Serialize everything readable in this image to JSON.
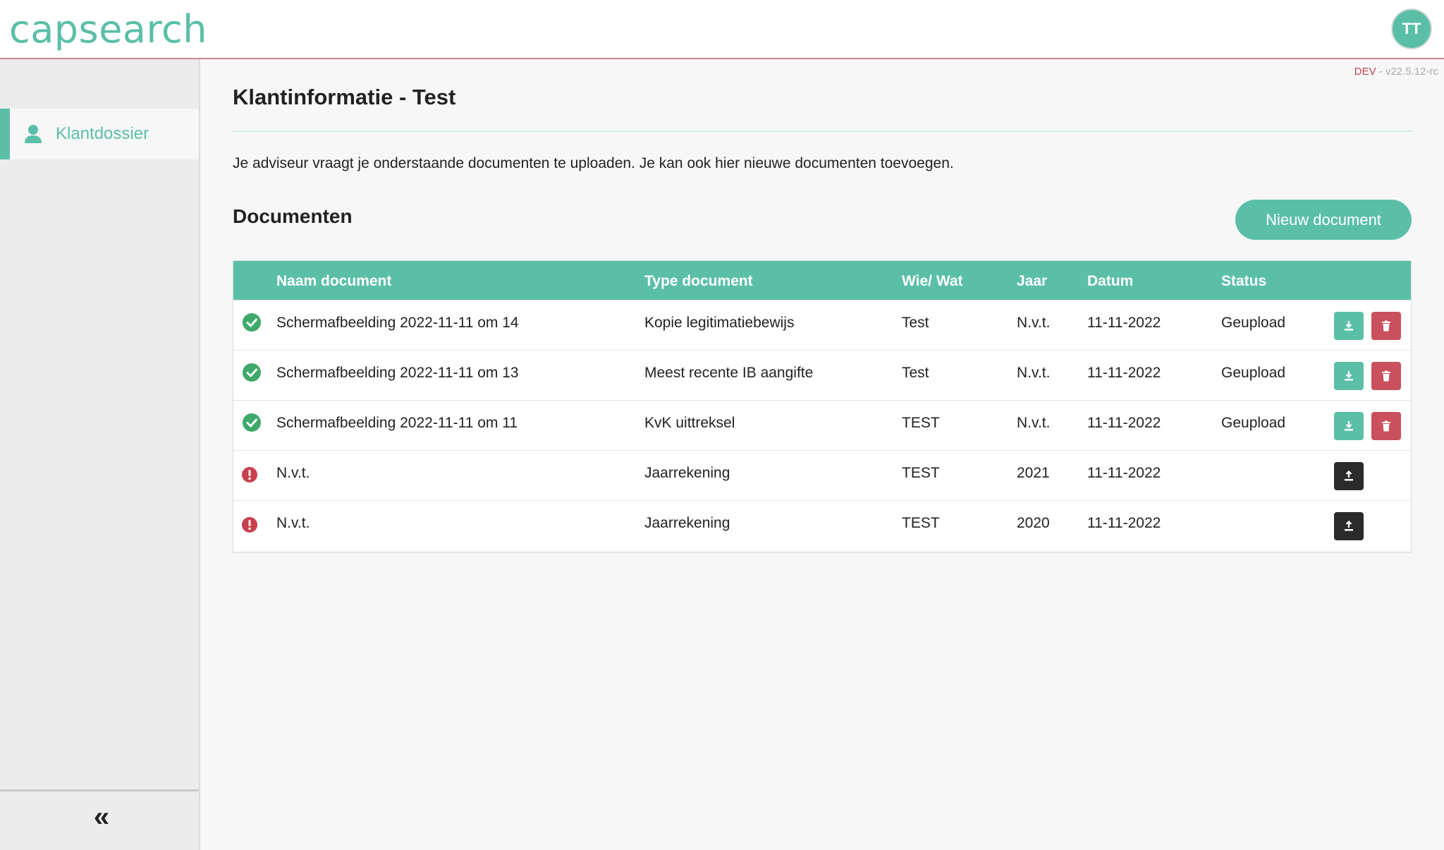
{
  "app": {
    "logo": "capsearch",
    "user_initials": "TT",
    "env_label": "DEV",
    "env_separator": " - ",
    "version": "v22.5.12-rc"
  },
  "sidebar": {
    "items": [
      {
        "label": "Klantdossier",
        "icon": "person-icon",
        "active": true
      }
    ],
    "collapse_icon": "double-chevron-left-icon",
    "collapse_glyph": "«"
  },
  "main": {
    "title": "Klantinformatie - Test",
    "intro": "Je adviseur vraagt je onderstaande documenten te uploaden. Je kan ook hier nieuwe documenten toevoegen.",
    "section_title": "Documenten",
    "new_button": "Nieuw document"
  },
  "table": {
    "headers": {
      "name": "Naam document",
      "type": "Type document",
      "who": "Wie/ Wat",
      "year": "Jaar",
      "date": "Datum",
      "status": "Status"
    },
    "rows": [
      {
        "state": "ok",
        "name": "Schermafbeelding 2022-11-11 om 14",
        "type": "Kopie legitimatiebewijs",
        "who": "Test",
        "year": "N.v.t.",
        "date": "11-11-2022",
        "status": "Geupload",
        "actions": [
          "download-icon",
          "trash-icon"
        ]
      },
      {
        "state": "ok",
        "name": "Schermafbeelding 2022-11-11 om 13",
        "type": "Meest recente IB aangifte",
        "who": "Test",
        "year": "N.v.t.",
        "date": "11-11-2022",
        "status": "Geupload",
        "actions": [
          "download-icon",
          "trash-icon"
        ]
      },
      {
        "state": "ok",
        "name": "Schermafbeelding 2022-11-11 om 11",
        "type": "KvK uittreksel",
        "who": "TEST",
        "year": "N.v.t.",
        "date": "11-11-2022",
        "status": "Geupload",
        "actions": [
          "download-icon",
          "trash-icon"
        ]
      },
      {
        "state": "missing",
        "name": "N.v.t.",
        "type": "Jaarrekening",
        "who": "TEST",
        "year": "2021",
        "date": "11-11-2022",
        "status": "",
        "actions": [
          "upload-icon"
        ]
      },
      {
        "state": "missing",
        "name": "N.v.t.",
        "type": "Jaarrekening",
        "who": "TEST",
        "year": "2020",
        "date": "11-11-2022",
        "status": "",
        "actions": [
          "upload-icon"
        ]
      }
    ]
  },
  "colors": {
    "accent": "#5bbfa8",
    "danger": "#c9505c",
    "ok": "#3fa86b",
    "dark": "#2b2b2b",
    "env": "#c0444f"
  }
}
